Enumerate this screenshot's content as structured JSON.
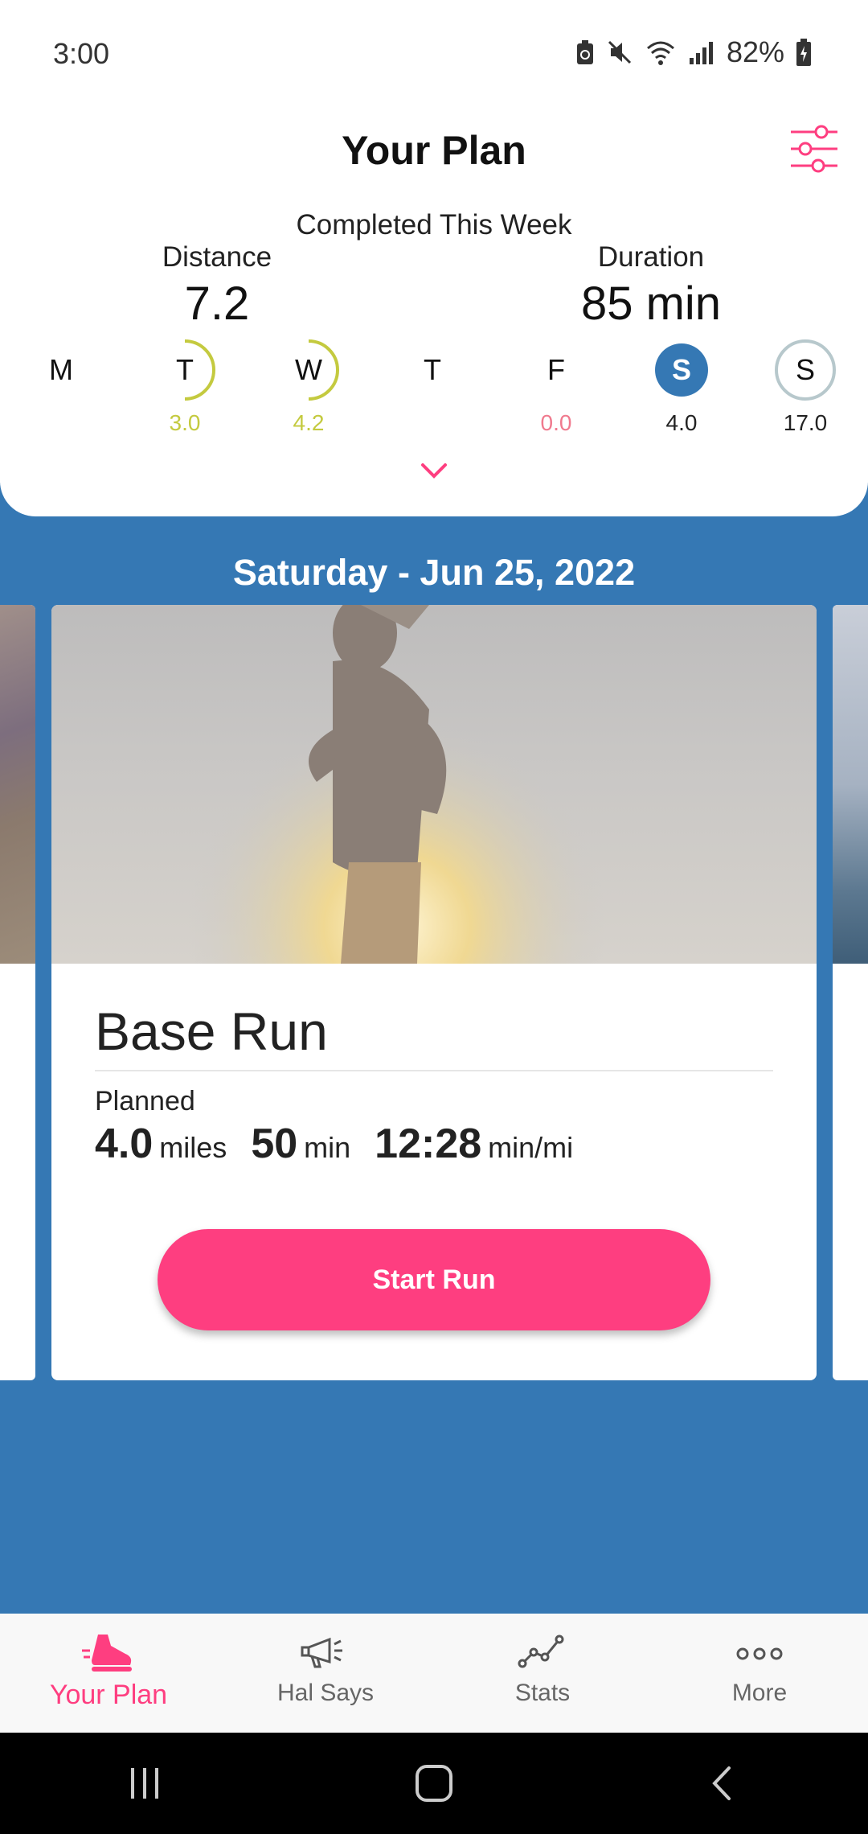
{
  "status_bar": {
    "time": "3:00",
    "battery": "82%",
    "icons": [
      "recycle-icon",
      "mute-icon",
      "wifi-icon",
      "signal-icon",
      "battery-icon"
    ]
  },
  "header": {
    "title": "Your Plan",
    "filter_icon": "sliders-icon",
    "week_label": "Completed This Week",
    "distance_label": "Distance",
    "distance_value": "7.2",
    "duration_label": "Duration",
    "duration_value": "85 min"
  },
  "days": [
    {
      "letter": "M",
      "value": "",
      "state": "none"
    },
    {
      "letter": "T",
      "value": "3.0",
      "state": "partial"
    },
    {
      "letter": "W",
      "value": "4.2",
      "state": "partial"
    },
    {
      "letter": "T",
      "value": "",
      "state": "none"
    },
    {
      "letter": "F",
      "value": "0.0",
      "state": "missed"
    },
    {
      "letter": "S",
      "value": "4.0",
      "state": "selected"
    },
    {
      "letter": "S",
      "value": "17.0",
      "state": "upcoming"
    }
  ],
  "colors": {
    "accent": "#fe3e80",
    "blue": "#3578b4",
    "partial": "#c4ca3f",
    "missed": "#f07a8e",
    "upcoming_ring": "#b7c8cc"
  },
  "date_title": "Saturday - Jun 25, 2022",
  "workout": {
    "name": "Base Run",
    "planned_label": "Planned",
    "distance_value": "4.0",
    "distance_unit": "miles",
    "duration_value": "50",
    "duration_unit": "min",
    "pace_value": "12:28",
    "pace_unit": "min/mi",
    "start_label": "Start Run"
  },
  "bottom_nav": [
    {
      "label": "Your Plan",
      "icon": "running-shoe-icon",
      "active": true
    },
    {
      "label": "Hal Says",
      "icon": "megaphone-icon",
      "active": false
    },
    {
      "label": "Stats",
      "icon": "line-chart-icon",
      "active": false
    },
    {
      "label": "More",
      "icon": "more-dots-icon",
      "active": false
    }
  ]
}
